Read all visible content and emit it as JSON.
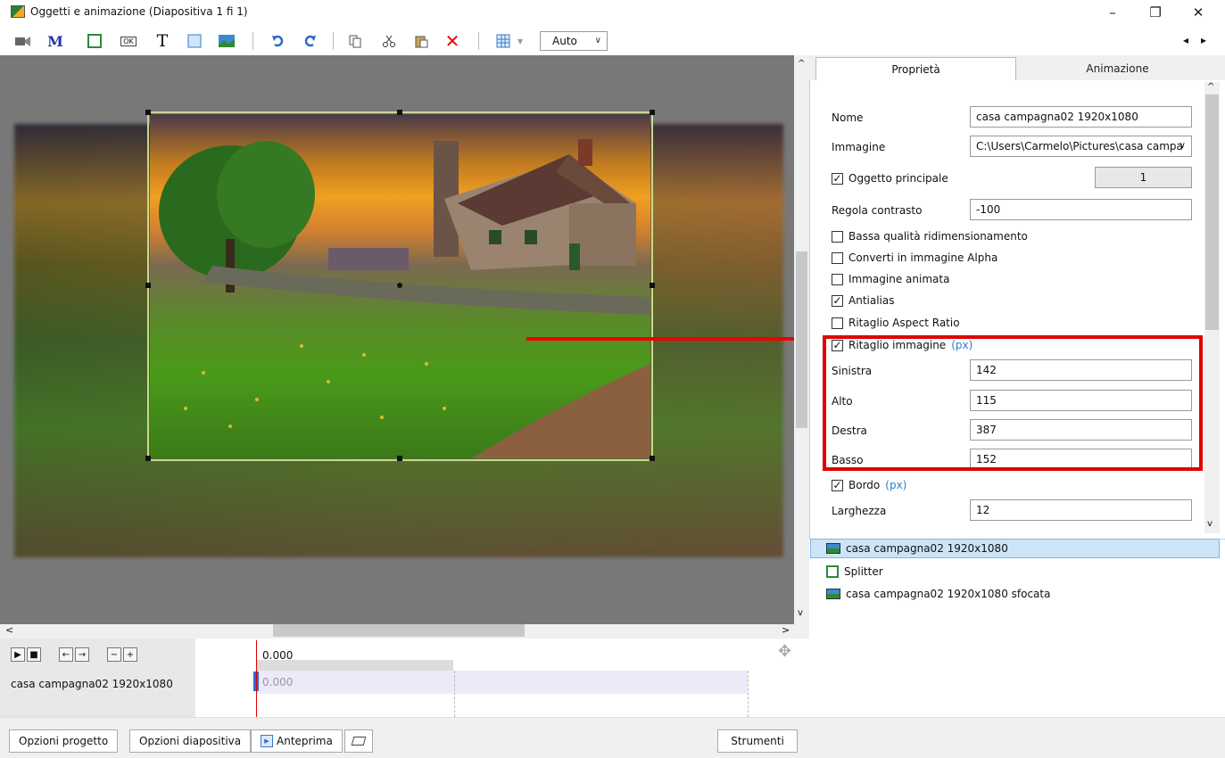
{
  "window": {
    "title": "Oggetti e animazione (Diapositiva 1 fi 1)",
    "minimize": "–",
    "restore": "❐",
    "close": "✕"
  },
  "toolbar": {
    "auto_value": "Auto",
    "nav_prev": "◂",
    "nav_next": "▸",
    "text_tool": "T",
    "mask_tool": "M",
    "ok_tool": "OK",
    "delete_tool": "✕"
  },
  "tabs": [
    {
      "label": "Proprietà"
    },
    {
      "label": "Animazione"
    }
  ],
  "properties": {
    "nome_label": "Nome",
    "nome_value": "casa campagna02 1920x1080",
    "immagine_label": "Immagine",
    "immagine_value": "C:\\Users\\Carmelo\\Pictures\\casa campa",
    "oggetto_principale_label": "Oggetto principale",
    "oggetto_principale_value": "1",
    "regola_contrasto_label": "Regola contrasto",
    "regola_contrasto_value": "-100",
    "bassa_qualita_label": "Bassa qualità ridimensionamento",
    "converti_alpha_label": "Converti in immagine Alpha",
    "immagine_animata_label": "Immagine animata",
    "antialias_label": "Antialias",
    "ritaglio_aspect_label": "Ritaglio Aspect Ratio",
    "ritaglio_immagine_label": "Ritaglio immagine",
    "px_unit": "(px)",
    "sinistra_label": "Sinistra",
    "sinistra_value": "142",
    "alto_label": "Alto",
    "alto_value": "115",
    "destra_label": "Destra",
    "destra_value": "387",
    "basso_label": "Basso",
    "basso_value": "152",
    "bordo_label": "Bordo",
    "larghezza_label": "Larghezza",
    "larghezza_value": "12"
  },
  "objects": [
    {
      "label": "casa campagna02 1920x1080"
    },
    {
      "label": "Splitter"
    },
    {
      "label": "casa campagna02 1920x1080 sfocata"
    }
  ],
  "timeline": {
    "time_value": "0.000",
    "track_time": "0.000",
    "track_name": "casa campagna02 1920x1080"
  },
  "bottom": {
    "opzioni_progetto": "Opzioni progetto",
    "opzioni_diapositiva": "Opzioni diapositiva",
    "anteprima": "Anteprima",
    "strumenti": "Strumenti"
  },
  "scroll": {
    "left": "<",
    "right": ">",
    "up": "^",
    "down": "v"
  }
}
